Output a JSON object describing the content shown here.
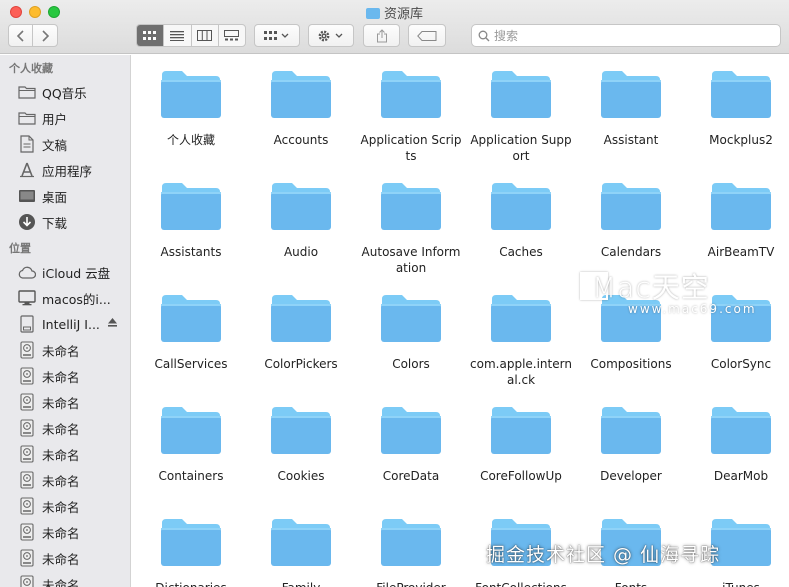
{
  "window": {
    "title": "资源库",
    "title_icon": "folder-icon"
  },
  "toolbar": {
    "back_icon": "chevron-left-icon",
    "forward_icon": "chevron-right-icon",
    "view_modes": [
      "icon-view-icon",
      "list-view-icon",
      "column-view-icon",
      "gallery-view-icon"
    ],
    "active_view": 0,
    "arrange_icon": "grid-arrange-icon",
    "action_icon": "gear-icon",
    "share_icon": "share-icon",
    "tag_icon": "tag-icon",
    "search_placeholder": "搜索"
  },
  "sidebar": {
    "favorites_header": "个人收藏",
    "favorites": [
      {
        "label": "QQ音乐",
        "icon": "folder-icon"
      },
      {
        "label": "用户",
        "icon": "folder-icon"
      },
      {
        "label": "文稿",
        "icon": "document-icon"
      },
      {
        "label": "应用程序",
        "icon": "applications-icon"
      },
      {
        "label": "桌面",
        "icon": "desktop-icon"
      },
      {
        "label": "下载",
        "icon": "download-icon"
      }
    ],
    "locations_header": "位置",
    "locations": [
      {
        "label": "iCloud 云盘",
        "icon": "cloud-icon"
      },
      {
        "label": "macos的i...",
        "icon": "computer-icon"
      },
      {
        "label": "IntelliJ I...",
        "icon": "disk-icon",
        "eject": true
      },
      {
        "label": "未命名",
        "icon": "drive-icon"
      },
      {
        "label": "未命名",
        "icon": "drive-icon"
      },
      {
        "label": "未命名",
        "icon": "drive-icon"
      },
      {
        "label": "未命名",
        "icon": "drive-icon"
      },
      {
        "label": "未命名",
        "icon": "drive-icon"
      },
      {
        "label": "未命名",
        "icon": "drive-icon"
      },
      {
        "label": "未命名",
        "icon": "drive-icon"
      },
      {
        "label": "未命名",
        "icon": "drive-icon"
      },
      {
        "label": "未命名",
        "icon": "drive-icon"
      },
      {
        "label": "未命名",
        "icon": "drive-icon"
      }
    ]
  },
  "folders": [
    "个人收藏",
    "Accounts",
    "Application Scripts",
    "Application Support",
    "Assistant",
    "Mockplus2",
    "Assistants",
    "Audio",
    "Autosave Information",
    "Caches",
    "Calendars",
    "AirBeamTV",
    "CallServices",
    "ColorPickers",
    "Colors",
    "com.apple.internal.ck",
    "Compositions",
    "ColorSync",
    "Containers",
    "Cookies",
    "CoreData",
    "CoreFollowUp",
    "Developer",
    "DearMob",
    "Dictionaries",
    "Family",
    "FileProvider",
    "FontCollections",
    "Fonts",
    "iTunes"
  ],
  "colors": {
    "folder_top": "#7ccbf6",
    "folder_body": "#6ab8ee",
    "sidebar_bg": "#e9e9ec"
  },
  "watermarks": {
    "brand": "Mac天空",
    "url": "www.mac69.com",
    "credit": "掘金技术社区 @ 仙海寻踪"
  }
}
